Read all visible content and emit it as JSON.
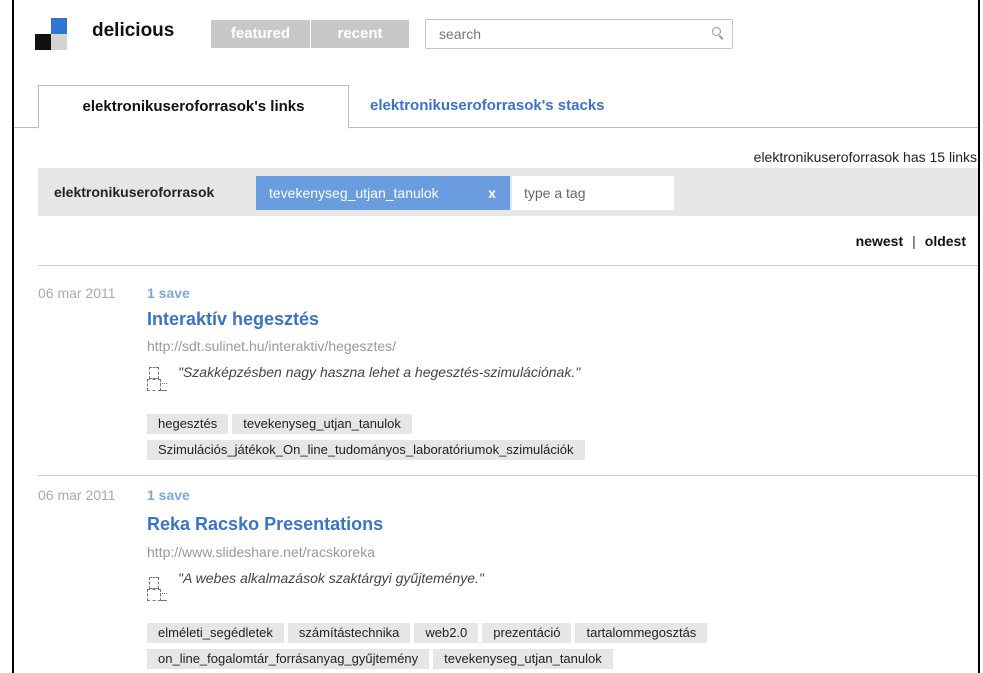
{
  "header": {
    "brand": "delicious",
    "nav": [
      {
        "label": "featured"
      },
      {
        "label": "recent"
      }
    ],
    "search_placeholder": "search"
  },
  "tabs": [
    {
      "label": "elektronikuseroforrasok's links",
      "active": true
    },
    {
      "label": "elektronikuseroforrasok's stacks",
      "active": false
    }
  ],
  "count_text": "elektronikuseroforrasok has 15 links",
  "tagbar": {
    "user": "elektronikuseroforrasok",
    "active_tag": "tevekenyseg_utjan_tanulok",
    "remove_label": "x",
    "input_placeholder": "type a tag"
  },
  "sort": {
    "newest": "newest",
    "separator": "|",
    "oldest": "oldest"
  },
  "colors": {
    "accent_blue": "#3b73c8",
    "active_tag_bg": "#6a9ce0",
    "tag_bg": "#e6e6e6",
    "nav_bg": "#c8c8c8"
  },
  "links": [
    {
      "date": "06 mar 2011",
      "saves": "1 save",
      "title": "Interaktív hegesztés",
      "url": "http://sdt.sulinet.hu/interaktiv/hegesztes/",
      "note": "\"Szakképzésben nagy haszna lehet a hegesztés-szimulációnak.\"",
      "tag_rows": [
        [
          "hegesztés",
          "tevekenyseg_utjan_tanulok"
        ],
        [
          "Szimulációs_játékok_On_line_tudományos_laboratóriumok_szimulációk"
        ]
      ]
    },
    {
      "date": "06 mar 2011",
      "saves": "1 save",
      "title": "Reka Racsko Presentations",
      "url": "http://www.slideshare.net/racskoreka",
      "note": "\"A webes alkalmazások szaktárgyi gyűjteménye.\"",
      "tag_rows": [
        [
          "elméleti_segédletek",
          "számítástechnika",
          "web2.0",
          "prezentáció",
          "tartalommegosztás"
        ],
        [
          "on_line_fogalomtár_forrásanyag_gyűjtemény",
          "tevekenyseg_utjan_tanulok"
        ]
      ]
    }
  ]
}
